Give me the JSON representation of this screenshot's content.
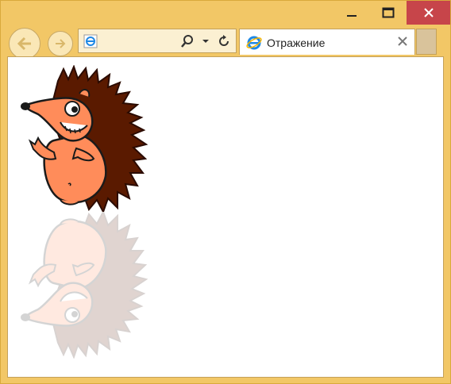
{
  "window": {
    "controls": {
      "minimize_icon": "minimize-icon",
      "maximize_icon": "maximize-icon",
      "close_icon": "close-icon"
    }
  },
  "navigation": {
    "back_icon": "back-arrow-icon",
    "forward_icon": "forward-arrow-icon",
    "address": {
      "value": "",
      "favicon": "ie-icon",
      "search_icon": "search-icon",
      "dropdown_icon": "chevron-down-icon",
      "refresh_icon": "refresh-icon"
    }
  },
  "tab": {
    "title": "Отражение",
    "icon": "ie-icon",
    "close_icon": "close-icon"
  },
  "content": {
    "image": "hedgehog-cartoon",
    "reflection": "hedgehog-reflection"
  },
  "colors": {
    "frame": "#f2c766",
    "close_button": "#c7454a",
    "spikes": "#5a1a00",
    "body": "#ff8c5a"
  }
}
